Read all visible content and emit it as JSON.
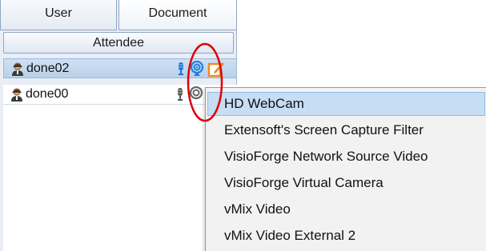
{
  "tabs": [
    {
      "label": "User"
    },
    {
      "label": "Document"
    }
  ],
  "attendee_header": "Attendee",
  "attendees": [
    {
      "name": "done02",
      "selected": true
    },
    {
      "name": "done00",
      "selected": false
    }
  ],
  "camera_menu": {
    "items": [
      {
        "label": "HD WebCam",
        "highlighted": true
      },
      {
        "label": "Extensoft's Screen Capture Filter"
      },
      {
        "label": "VisioForge Network Source Video"
      },
      {
        "label": "VisioForge Virtual Camera"
      },
      {
        "label": "vMix Video"
      },
      {
        "label": "vMix Video External 2"
      }
    ]
  },
  "colors": {
    "mic_active": "#1e6fd9",
    "mic_inactive": "#555555",
    "camera_active": "#1e7fe0",
    "edit_icon": "#f08a1c",
    "annotation_ellipse": "#e00000"
  }
}
